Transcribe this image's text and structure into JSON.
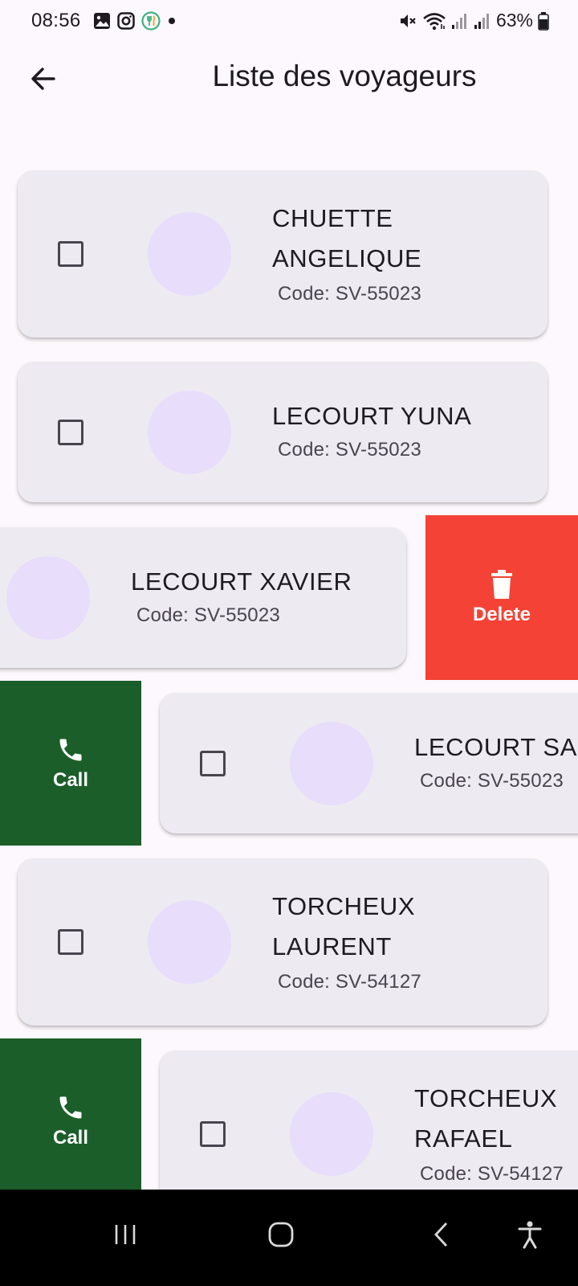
{
  "status_bar": {
    "time": "08:56",
    "battery_text": "63%"
  },
  "app_bar": {
    "title": "Liste des voyageurs"
  },
  "travelers": [
    {
      "name_line1": "CHUETTE",
      "name_line2": "ANGELIQUE",
      "code": "Code: SV-55023"
    },
    {
      "name_line1": "LECOURT YUNA",
      "name_line2": "",
      "code": "Code: SV-55023"
    },
    {
      "name_line1": "LECOURT XAVIER",
      "name_line2": "",
      "code": "Code: SV-55023"
    },
    {
      "name_line1": "LECOURT SA",
      "name_line2": "",
      "code": "Code: SV-55023"
    },
    {
      "name_line1": "TORCHEUX",
      "name_line2": "LAURENT",
      "code": "Code: SV-54127"
    },
    {
      "name_line1": "TORCHEUX",
      "name_line2": "RAFAEL",
      "code": "Code: SV-54127"
    }
  ],
  "actions": {
    "delete_label": "Delete",
    "call_label": "Call"
  },
  "colors": {
    "delete": "#f44336",
    "call": "#1b5e29",
    "card": "#eeeaf2",
    "avatar": "#e8ddfb"
  },
  "icons": {
    "back": "arrow-back-icon",
    "delete": "trash-icon",
    "call": "phone-icon"
  }
}
